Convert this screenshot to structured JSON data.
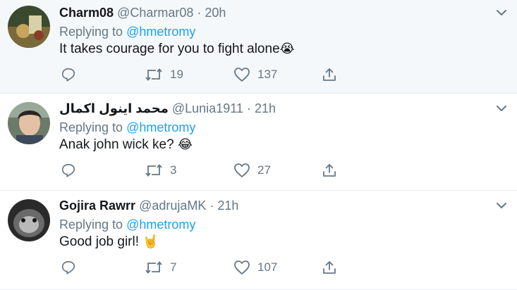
{
  "colors": {
    "link": "#1da1f2",
    "muted": "#657786",
    "text": "#14171a",
    "highlight_bg": "#f5f8fa",
    "divider": "#e6ecf0"
  },
  "tweets": [
    {
      "name": "Charm08",
      "handle": "@Charmar08",
      "dot": "·",
      "time": "20h",
      "replying_prefix": "Replying to",
      "replying_to": "@hmetromy",
      "text": "It takes courage for you to fight alone",
      "emoji": "😭",
      "retweets": "19",
      "likes": "137",
      "avatar_icon": "avatar-photo"
    },
    {
      "name": "محمد اينول اكمال",
      "handle": "@Lunia1911",
      "dot": "·",
      "time": "21h",
      "replying_prefix": "Replying to",
      "replying_to": "@hmetromy",
      "text": "Anak john wick ke?",
      "emoji": "😂",
      "retweets": "3",
      "likes": "27",
      "avatar_icon": "avatar-photo"
    },
    {
      "name": "Gojira Rawrr",
      "handle": "@adrujaMK",
      "dot": "·",
      "time": "21h",
      "replying_prefix": "Replying to",
      "replying_to": "@hmetromy",
      "text": "Good job girl!",
      "emoji": "🤘",
      "retweets": "7",
      "likes": "107",
      "avatar_icon": "avatar-photo"
    }
  ],
  "icons": {
    "reply": "reply-icon",
    "retweet": "retweet-icon",
    "like": "heart-icon",
    "share": "share-icon",
    "more": "chevron-down-icon"
  }
}
